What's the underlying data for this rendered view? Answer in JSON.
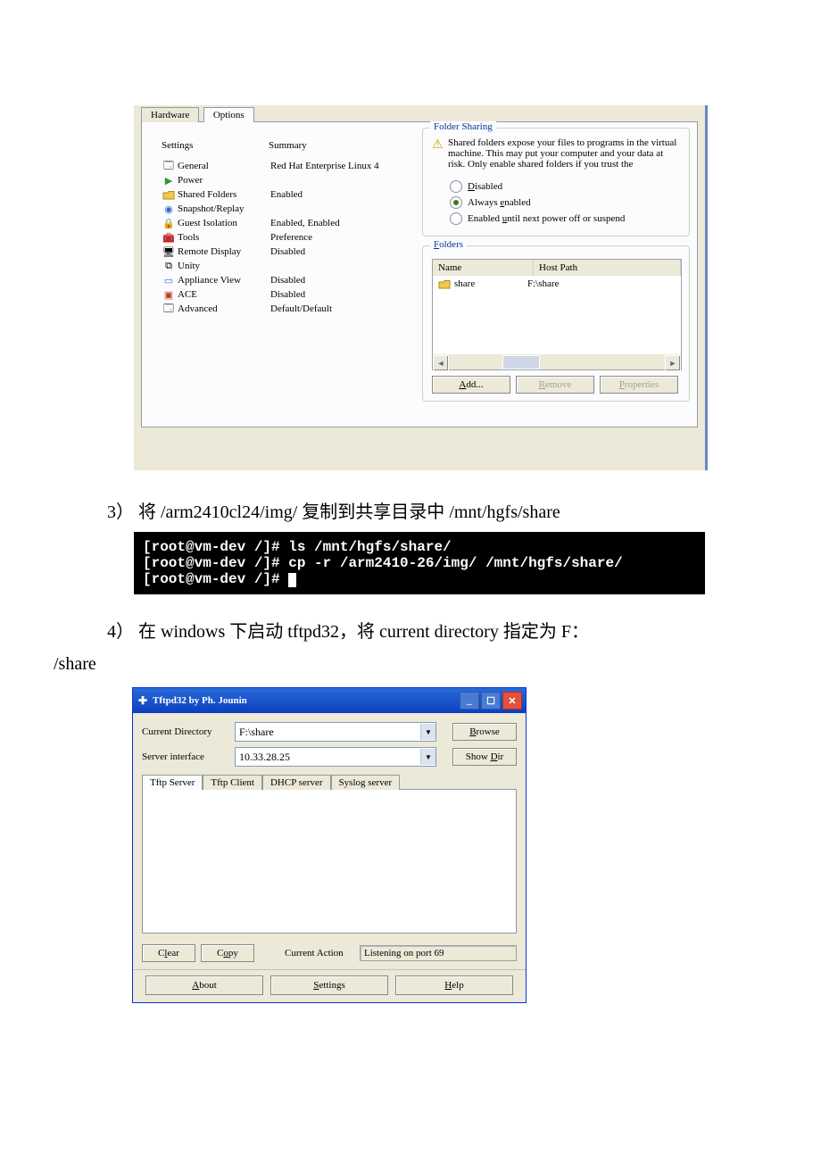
{
  "vmware": {
    "tabs": {
      "hardware": "Hardware",
      "options": "Options"
    },
    "headers": {
      "settings": "Settings",
      "summary": "Summary"
    },
    "rows": {
      "general": {
        "name": "General",
        "summary": "Red Hat Enterprise Linux 4"
      },
      "power": {
        "name": "Power",
        "summary": ""
      },
      "sharedFolders": {
        "name": "Shared Folders",
        "summary": "Enabled"
      },
      "snapshot": {
        "name": "Snapshot/Replay",
        "summary": ""
      },
      "guestIsolation": {
        "name": "Guest Isolation",
        "summary": "Enabled, Enabled"
      },
      "tools": {
        "name": "Tools",
        "summary": "Preference"
      },
      "remoteDisplay": {
        "name": "Remote Display",
        "summary": "Disabled"
      },
      "unity": {
        "name": "Unity",
        "summary": ""
      },
      "applianceView": {
        "name": "Appliance View",
        "summary": "Disabled"
      },
      "ace": {
        "name": "ACE",
        "summary": "Disabled"
      },
      "advanced": {
        "name": "Advanced",
        "summary": "Default/Default"
      }
    },
    "right": {
      "sharingTitle": "Folder Sharing",
      "warning": "Shared folders expose your files to programs in the virtual machine. This may put your computer and your data at risk. Only enable shared folders if you trust the",
      "radios": {
        "disabled": "Disabled",
        "always": "Always enabled",
        "until": "Enabled until next power off or suspend"
      },
      "foldersTitle": "Folders",
      "tableHead": {
        "name": "Name",
        "hostPath": "Host Path"
      },
      "tableRow": {
        "name": "share",
        "hostPath": "F:\\share"
      },
      "buttons": {
        "add": "Add...",
        "remove": "Remove",
        "properties": "Properties"
      }
    }
  },
  "step3": {
    "prefix": "3） 将 ",
    "path1": "/arm2410cl24/img/",
    "mid": " 复制到共享目录中 ",
    "path2": "/mnt/hgfs/share"
  },
  "terminal": {
    "line1": "[root@vm-dev /]# ls /mnt/hgfs/share/",
    "line2": "[root@vm-dev /]# cp -r /arm2410-26/img/ /mnt/hgfs/share/",
    "line3": "[root@vm-dev /]# "
  },
  "step4": {
    "text_a": "4） 在 windows 下启动 tftpd32，将 current directory 指定为 F：",
    "text_b": "/share"
  },
  "tftp": {
    "title": "Tftpd32 by Ph. Jounin",
    "currentDirLabel": "Current Directory",
    "currentDirValue": "F:\\share",
    "serverIfLabel": "Server interface",
    "serverIfValue": "10.33.28.25",
    "browse": "Browse",
    "showDir": "Show Dir",
    "tabs": {
      "server": "Tftp Server",
      "client": "Tftp Client",
      "dhcp": "DHCP server",
      "syslog": "Syslog server"
    },
    "clear": "Clear",
    "copy": "Copy",
    "currentActionLabel": "Current Action",
    "currentActionValue": "Listening on port 69",
    "about": "About",
    "settings": "Settings",
    "help": "Help"
  }
}
